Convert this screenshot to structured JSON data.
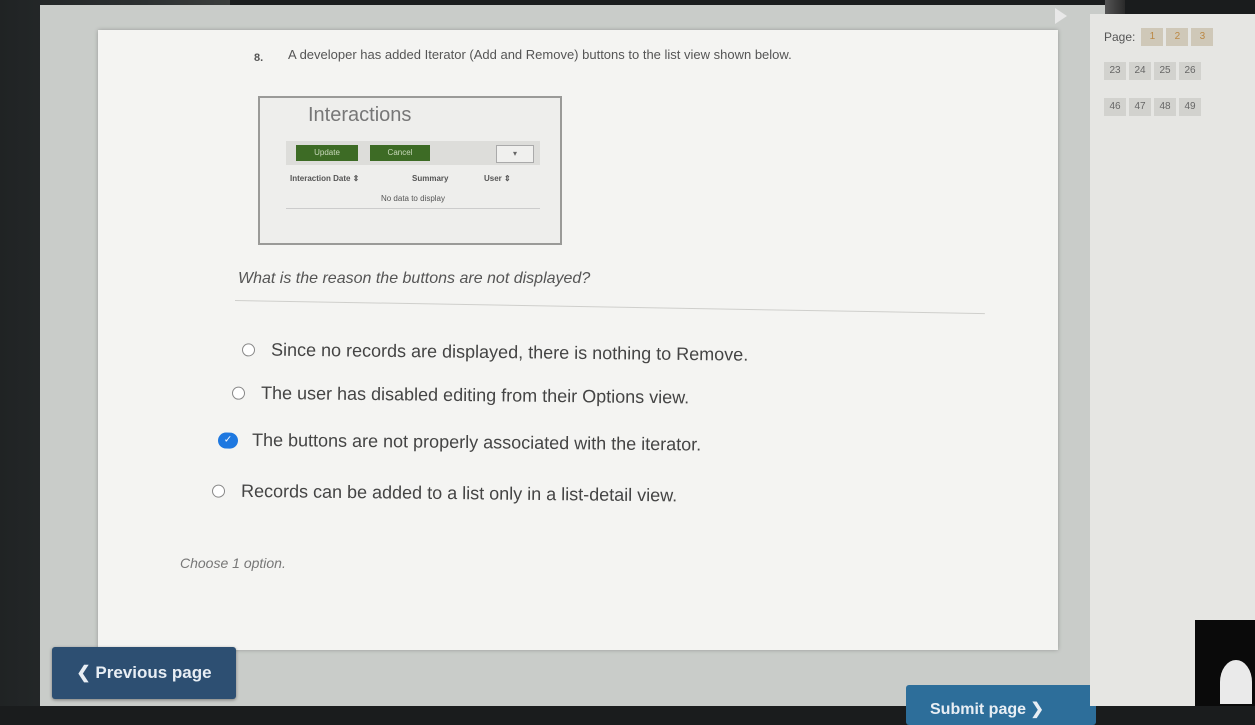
{
  "question": {
    "number": "8.",
    "text": "A developer has added Iterator (Add and Remove) buttons to the list view shown below.",
    "prompt": "What is the reason the buttons are not displayed?",
    "hint": "Choose 1 option."
  },
  "figure": {
    "title": "Interactions",
    "update_label": "Update",
    "cancel_label": "Cancel",
    "select_label": "▾",
    "headers": [
      "Interaction Date ⇕",
      "Summary",
      "User ⇕"
    ],
    "empty_text": "No data to display"
  },
  "options": [
    {
      "label": "Since no records are displayed, there is nothing to Remove.",
      "selected": false
    },
    {
      "label": "The user has disabled editing from their Options view.",
      "selected": false
    },
    {
      "label": "The buttons are not properly associated with the iterator.",
      "selected": true
    },
    {
      "label": "Records can be added to a list only in a list-detail view.",
      "selected": false
    }
  ],
  "nav": {
    "page_label": "Page:",
    "rows": [
      [
        "1",
        "2",
        "3"
      ],
      [
        "23",
        "24",
        "25",
        "26"
      ],
      [
        "46",
        "47",
        "48",
        "49"
      ]
    ]
  },
  "buttons": {
    "previous": "❮ Previous page",
    "submit": "Submit page ❯"
  },
  "colors": {
    "accent_blue": "#1e78e0",
    "prev_button": "#2d4f72",
    "figure_button_green": "#3d6b25"
  }
}
